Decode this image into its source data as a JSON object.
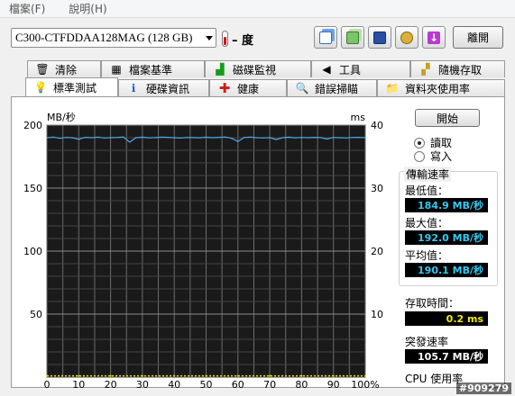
{
  "menu": {
    "file": "檔案(F)",
    "help": "說明(H)"
  },
  "drive": {
    "selected": "C300-CTFDDAA128MAG (128 GB)"
  },
  "temperature": {
    "value": "– 度"
  },
  "toolbar": {
    "exit_label": "離開"
  },
  "tabs": {
    "row1": [
      {
        "label": "清除",
        "icon": "trash-icon"
      },
      {
        "label": "檔案基準",
        "icon": "file-benchmark-icon"
      },
      {
        "label": "磁碟監視",
        "icon": "disk-monitor-icon"
      },
      {
        "label": "工具",
        "icon": "speaker-tools-icon"
      },
      {
        "label": "隨機存取",
        "icon": "random-access-icon"
      }
    ],
    "row2": [
      {
        "label": "標準測試",
        "icon": "bulb-icon"
      },
      {
        "label": "硬碟資訊",
        "icon": "info-icon"
      },
      {
        "label": "健康",
        "icon": "health-cross-icon"
      },
      {
        "label": "錯誤掃瞄",
        "icon": "magnifier-icon"
      },
      {
        "label": "資料夾使用率",
        "icon": "folder-icon"
      }
    ]
  },
  "controls": {
    "start_label": "開始",
    "read_label": "讀取",
    "write_label": "寫入"
  },
  "stats": {
    "transfer_title": "傳輸速率",
    "min_label": "最低值：",
    "min_value": "184.9 MB/秒",
    "max_label": "最大值：",
    "max_value": "192.0 MB/秒",
    "avg_label": "平均值：",
    "avg_value": "190.1 MB/秒",
    "access_label": "存取時間：",
    "access_value": "0.2 ms",
    "burst_label": "突發速率",
    "burst_value": "105.7 MB/秒",
    "cpu_label": "CPU 使用率"
  },
  "watermark": "#909279",
  "colors": {
    "transfer_line": "#4aa8e8",
    "access_points": "#e8e000",
    "chart_bg": "#1a1a1a",
    "grid": "#6c6c6c"
  },
  "chart_data": {
    "type": "line",
    "left_unit": "MB/秒",
    "right_unit": "ms",
    "ylim": [
      0,
      200
    ],
    "y2lim": [
      0,
      40
    ],
    "yticks": [
      50,
      100,
      150,
      200
    ],
    "y2ticks": [
      10,
      20,
      30,
      40
    ],
    "xticks": [
      "0",
      "10",
      "20",
      "30",
      "40",
      "50",
      "60",
      "70",
      "80",
      "90",
      "100%"
    ],
    "series": [
      {
        "axis": "left",
        "x": [
          0,
          2,
          4,
          6,
          8,
          10,
          12,
          14,
          16,
          18,
          20,
          22,
          24,
          26,
          28,
          30,
          32,
          34,
          36,
          38,
          40,
          42,
          44,
          46,
          48,
          50,
          52,
          54,
          56,
          58,
          60,
          62,
          64,
          66,
          68,
          70,
          72,
          74,
          76,
          78,
          80,
          82,
          84,
          86,
          88,
          90,
          92,
          94,
          96,
          98,
          100
        ],
        "values": [
          190,
          190.5,
          189.5,
          190.2,
          190,
          188.8,
          190.3,
          190,
          190.5,
          189.8,
          190,
          190.2,
          190.6,
          186.5,
          190,
          190.4,
          189.9,
          190.1,
          190.5,
          190.3,
          190,
          189.7,
          190.2,
          190.1,
          189.9,
          190.4,
          190,
          190.3,
          190.6,
          189.6,
          187,
          190.2,
          190.5,
          190,
          189.8,
          190.1,
          188.5,
          190,
          190.4,
          189.9,
          190.2,
          190,
          190.3,
          190.1,
          188.9,
          190.2,
          190,
          189.8,
          190.2,
          190.3,
          190.1
        ]
      },
      {
        "axis": "right",
        "x": [
          0,
          10,
          20,
          30,
          40,
          50,
          60,
          70,
          80,
          90,
          100
        ],
        "values": [
          0.2,
          0.2,
          0.2,
          0.2,
          0.2,
          0.2,
          0.2,
          0.2,
          0.2,
          0.2,
          0.2
        ]
      }
    ]
  }
}
